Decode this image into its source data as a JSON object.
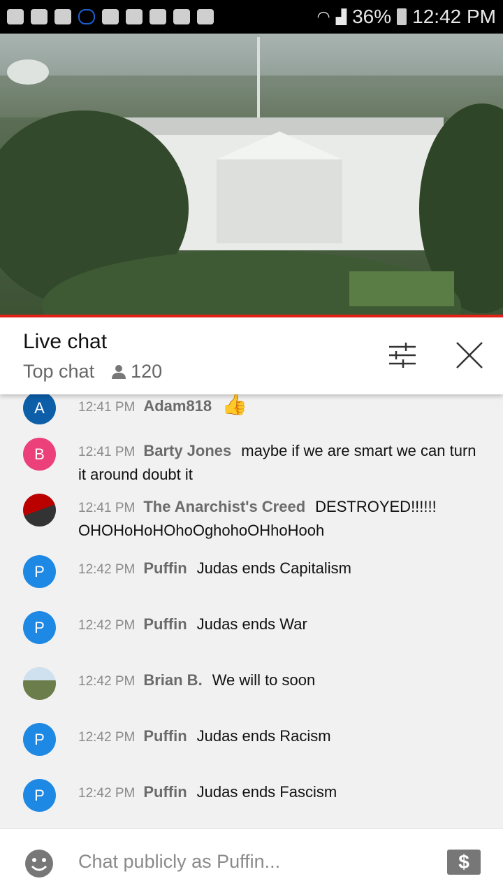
{
  "status_bar": {
    "battery": "36%",
    "time": "12:42 PM",
    "icons": [
      "app-icon",
      "crown-icon",
      "youtube-icon",
      "cloud-icon",
      "folder-icon",
      "warning-icon",
      "image-icon",
      "shopping-bag-icon",
      "play-store-icon",
      "wifi-icon",
      "signal-icon",
      "battery-icon"
    ]
  },
  "video": {
    "description_icon": "video-player"
  },
  "header": {
    "title": "Live chat",
    "mode": "Top chat",
    "viewers": "120"
  },
  "messages": [
    {
      "time": "12:41 PM",
      "author": "Adam818",
      "text": "👍",
      "avatar": "A",
      "color": "#0d5ea8"
    },
    {
      "time": "12:41 PM",
      "author": "Barty Jones",
      "text": "maybe if we are smart we can turn it around doubt it",
      "avatar": "B",
      "color": "#ec407a"
    },
    {
      "time": "12:41 PM",
      "author": "The Anarchist's Creed",
      "text": "DESTROYED!!!!!! OHOHoHoHOhoOghohoOHhoHooh",
      "avatar": "",
      "color": "#8b0000"
    },
    {
      "time": "12:42 PM",
      "author": "Puffin",
      "text": "Judas ends Capitalism",
      "avatar": "P",
      "color": "#1e88e5"
    },
    {
      "time": "12:42 PM",
      "author": "Puffin",
      "text": "Judas ends War",
      "avatar": "P",
      "color": "#1e88e5"
    },
    {
      "time": "12:42 PM",
      "author": "Brian B.",
      "text": "We will to soon",
      "avatar": "",
      "color": "#7a8a60"
    },
    {
      "time": "12:42 PM",
      "author": "Puffin",
      "text": "Judas ends Racism",
      "avatar": "P",
      "color": "#1e88e5"
    },
    {
      "time": "12:42 PM",
      "author": "Puffin",
      "text": "Judas ends Fascism",
      "avatar": "P",
      "color": "#1e88e5"
    }
  ],
  "footer": {
    "placeholder": "Chat publicly as Puffin..."
  }
}
